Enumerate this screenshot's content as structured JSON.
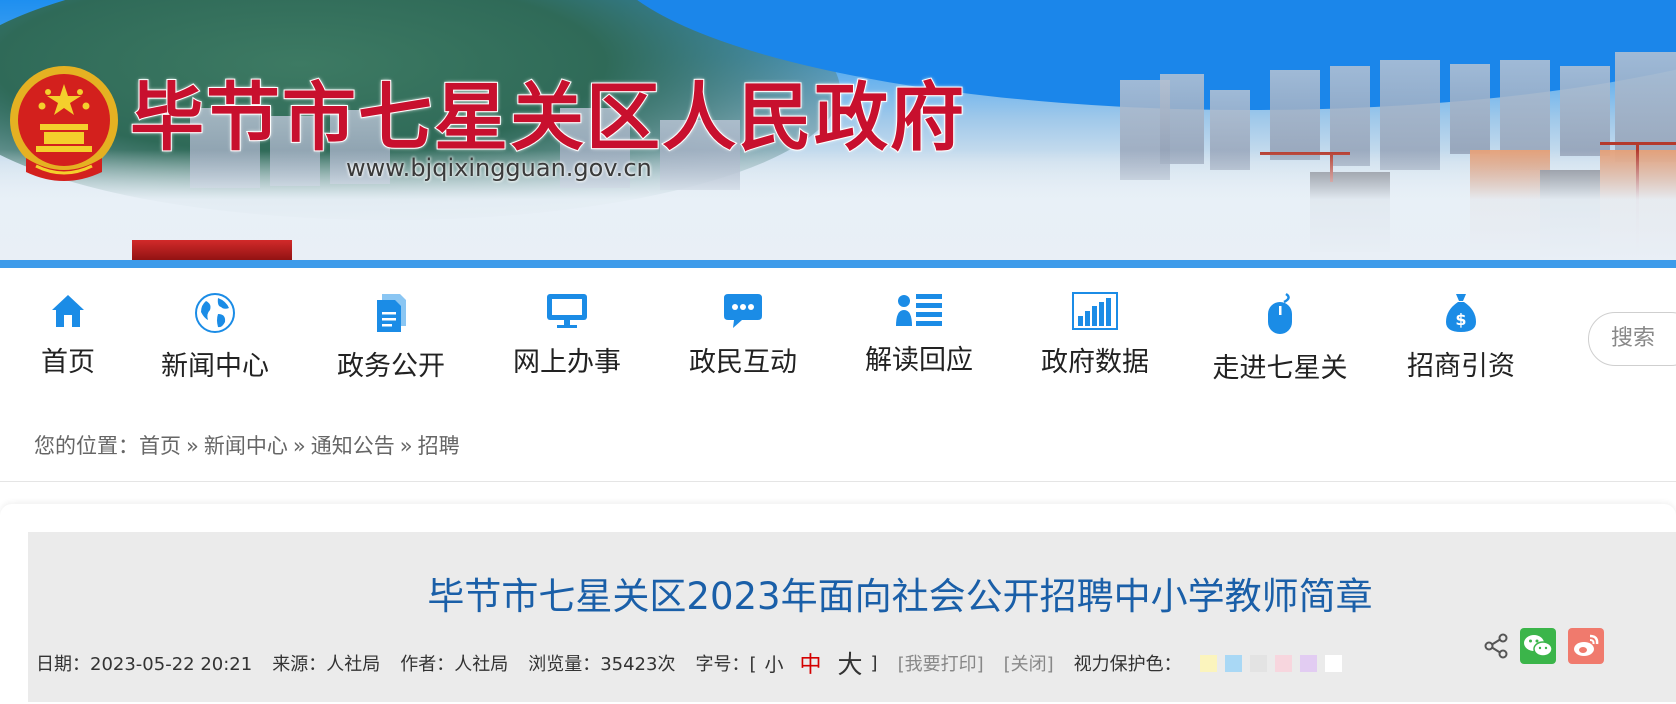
{
  "header": {
    "site_title": "毕节市七星关区人民政府",
    "site_url": "www.bjqixingguan.gov.cn"
  },
  "nav": {
    "items": [
      {
        "label": "首页",
        "icon": "home-icon"
      },
      {
        "label": "新闻中心",
        "icon": "globe-icon"
      },
      {
        "label": "政务公开",
        "icon": "document-icon"
      },
      {
        "label": "网上办事",
        "icon": "monitor-icon"
      },
      {
        "label": "政民互动",
        "icon": "chat-bubble-icon"
      },
      {
        "label": "解读回应",
        "icon": "person-list-icon"
      },
      {
        "label": "政府数据",
        "icon": "bar-chart-icon"
      },
      {
        "label": "走进七星关",
        "icon": "mouse-icon"
      },
      {
        "label": "招商引资",
        "icon": "money-bag-icon"
      }
    ],
    "search_placeholder": "搜索"
  },
  "breadcrumb": {
    "prefix": "您的位置：",
    "items": [
      "首页",
      "新闻中心",
      "通知公告",
      "招聘"
    ],
    "separator": "»"
  },
  "article": {
    "title": "毕节市七星关区2023年面向社会公开招聘中小学教师简章",
    "date": "日期：2023-05-22 20:21",
    "source": "来源：人社局",
    "author": "作者：人社局",
    "views": "浏览量：35423次",
    "font_size_label": "字号：[",
    "font_small": "小",
    "font_medium": "中",
    "font_large": "大",
    "font_close_bracket": "]",
    "print": "[我要打印]",
    "close": "[关闭]",
    "eye_color_label": "视力保护色：",
    "eye_colors": [
      "#fbf4bd",
      "#a9d8f5",
      "#e3e3e3",
      "#f7d6de",
      "#e2ccf2",
      "#ffffff"
    ]
  },
  "share": {
    "icons": [
      "share-icon",
      "wechat-icon",
      "weibo-icon"
    ],
    "wechat_color": "#3bb54a",
    "weibo_color": "#f07a6d"
  },
  "colors": {
    "title_red": "#c8102e",
    "nav_icon_blue": "#1b8ce6",
    "article_title_blue": "#1a5fa8"
  }
}
